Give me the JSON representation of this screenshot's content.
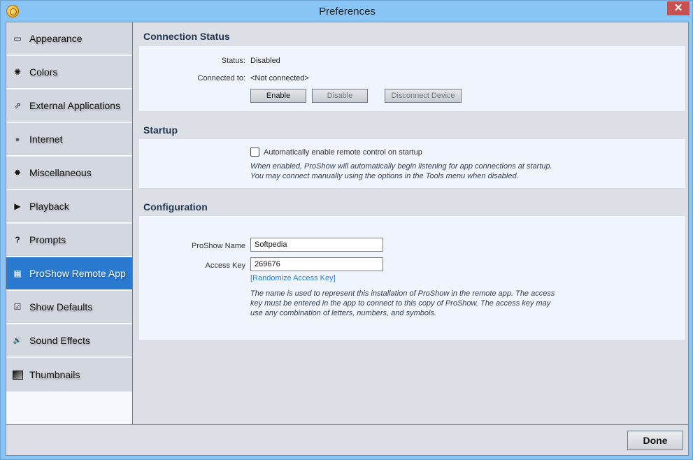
{
  "window": {
    "title": "Preferences",
    "close_glyph": "✕"
  },
  "sidebar": {
    "items": [
      {
        "label": "Appearance",
        "icon": "window-icon",
        "glyph": "▭"
      },
      {
        "label": "Colors",
        "icon": "color-wheel-icon",
        "glyph": "✺"
      },
      {
        "label": "External Applications",
        "icon": "external-app-icon",
        "glyph": "⇗"
      },
      {
        "label": "Internet",
        "icon": "globe-icon",
        "glyph": "●"
      },
      {
        "label": "Miscellaneous",
        "icon": "gear-icon",
        "glyph": "✹"
      },
      {
        "label": "Playback",
        "icon": "play-icon",
        "glyph": "▶"
      },
      {
        "label": "Prompts",
        "icon": "question-icon",
        "glyph": "?"
      },
      {
        "label": "ProShow Remote App",
        "icon": "remote-icon",
        "glyph": "▦"
      },
      {
        "label": "Show Defaults",
        "icon": "checkbox-icon",
        "glyph": "☑"
      },
      {
        "label": "Sound Effects",
        "icon": "speaker-icon",
        "glyph": "🔊"
      },
      {
        "label": "Thumbnails",
        "icon": "thumbnail-icon",
        "glyph": "■"
      }
    ],
    "active_index": 7
  },
  "connection": {
    "title": "Connection Status",
    "status_label": "Status:",
    "status_value": "Disabled",
    "connected_label": "Connected to:",
    "connected_value": "<Not connected>",
    "enable_label": "Enable",
    "disable_label": "Disable",
    "disconnect_label": "Disconnect Device"
  },
  "startup": {
    "title": "Startup",
    "checkbox_label": "Automatically enable remote control on startup",
    "checkbox_checked": false,
    "help_line1": "When enabled, ProShow will automatically begin listening for app connections at startup.",
    "help_line2": "You may connect manually using the options in the Tools menu when disabled."
  },
  "configuration": {
    "title": "Configuration",
    "name_label": "ProShow Name",
    "name_value": "Softpedia",
    "key_label": "Access Key",
    "key_value": "269676",
    "randomize_link": "[Randomize Access Key]",
    "help_line1": "The name is used to represent this installation of ProShow in the remote app. The access",
    "help_line2": "key must be entered in the app to connect to this copy of ProShow. The access key may",
    "help_line3": "use any combination of letters, numbers, and symbols."
  },
  "footer": {
    "done_label": "Done"
  }
}
